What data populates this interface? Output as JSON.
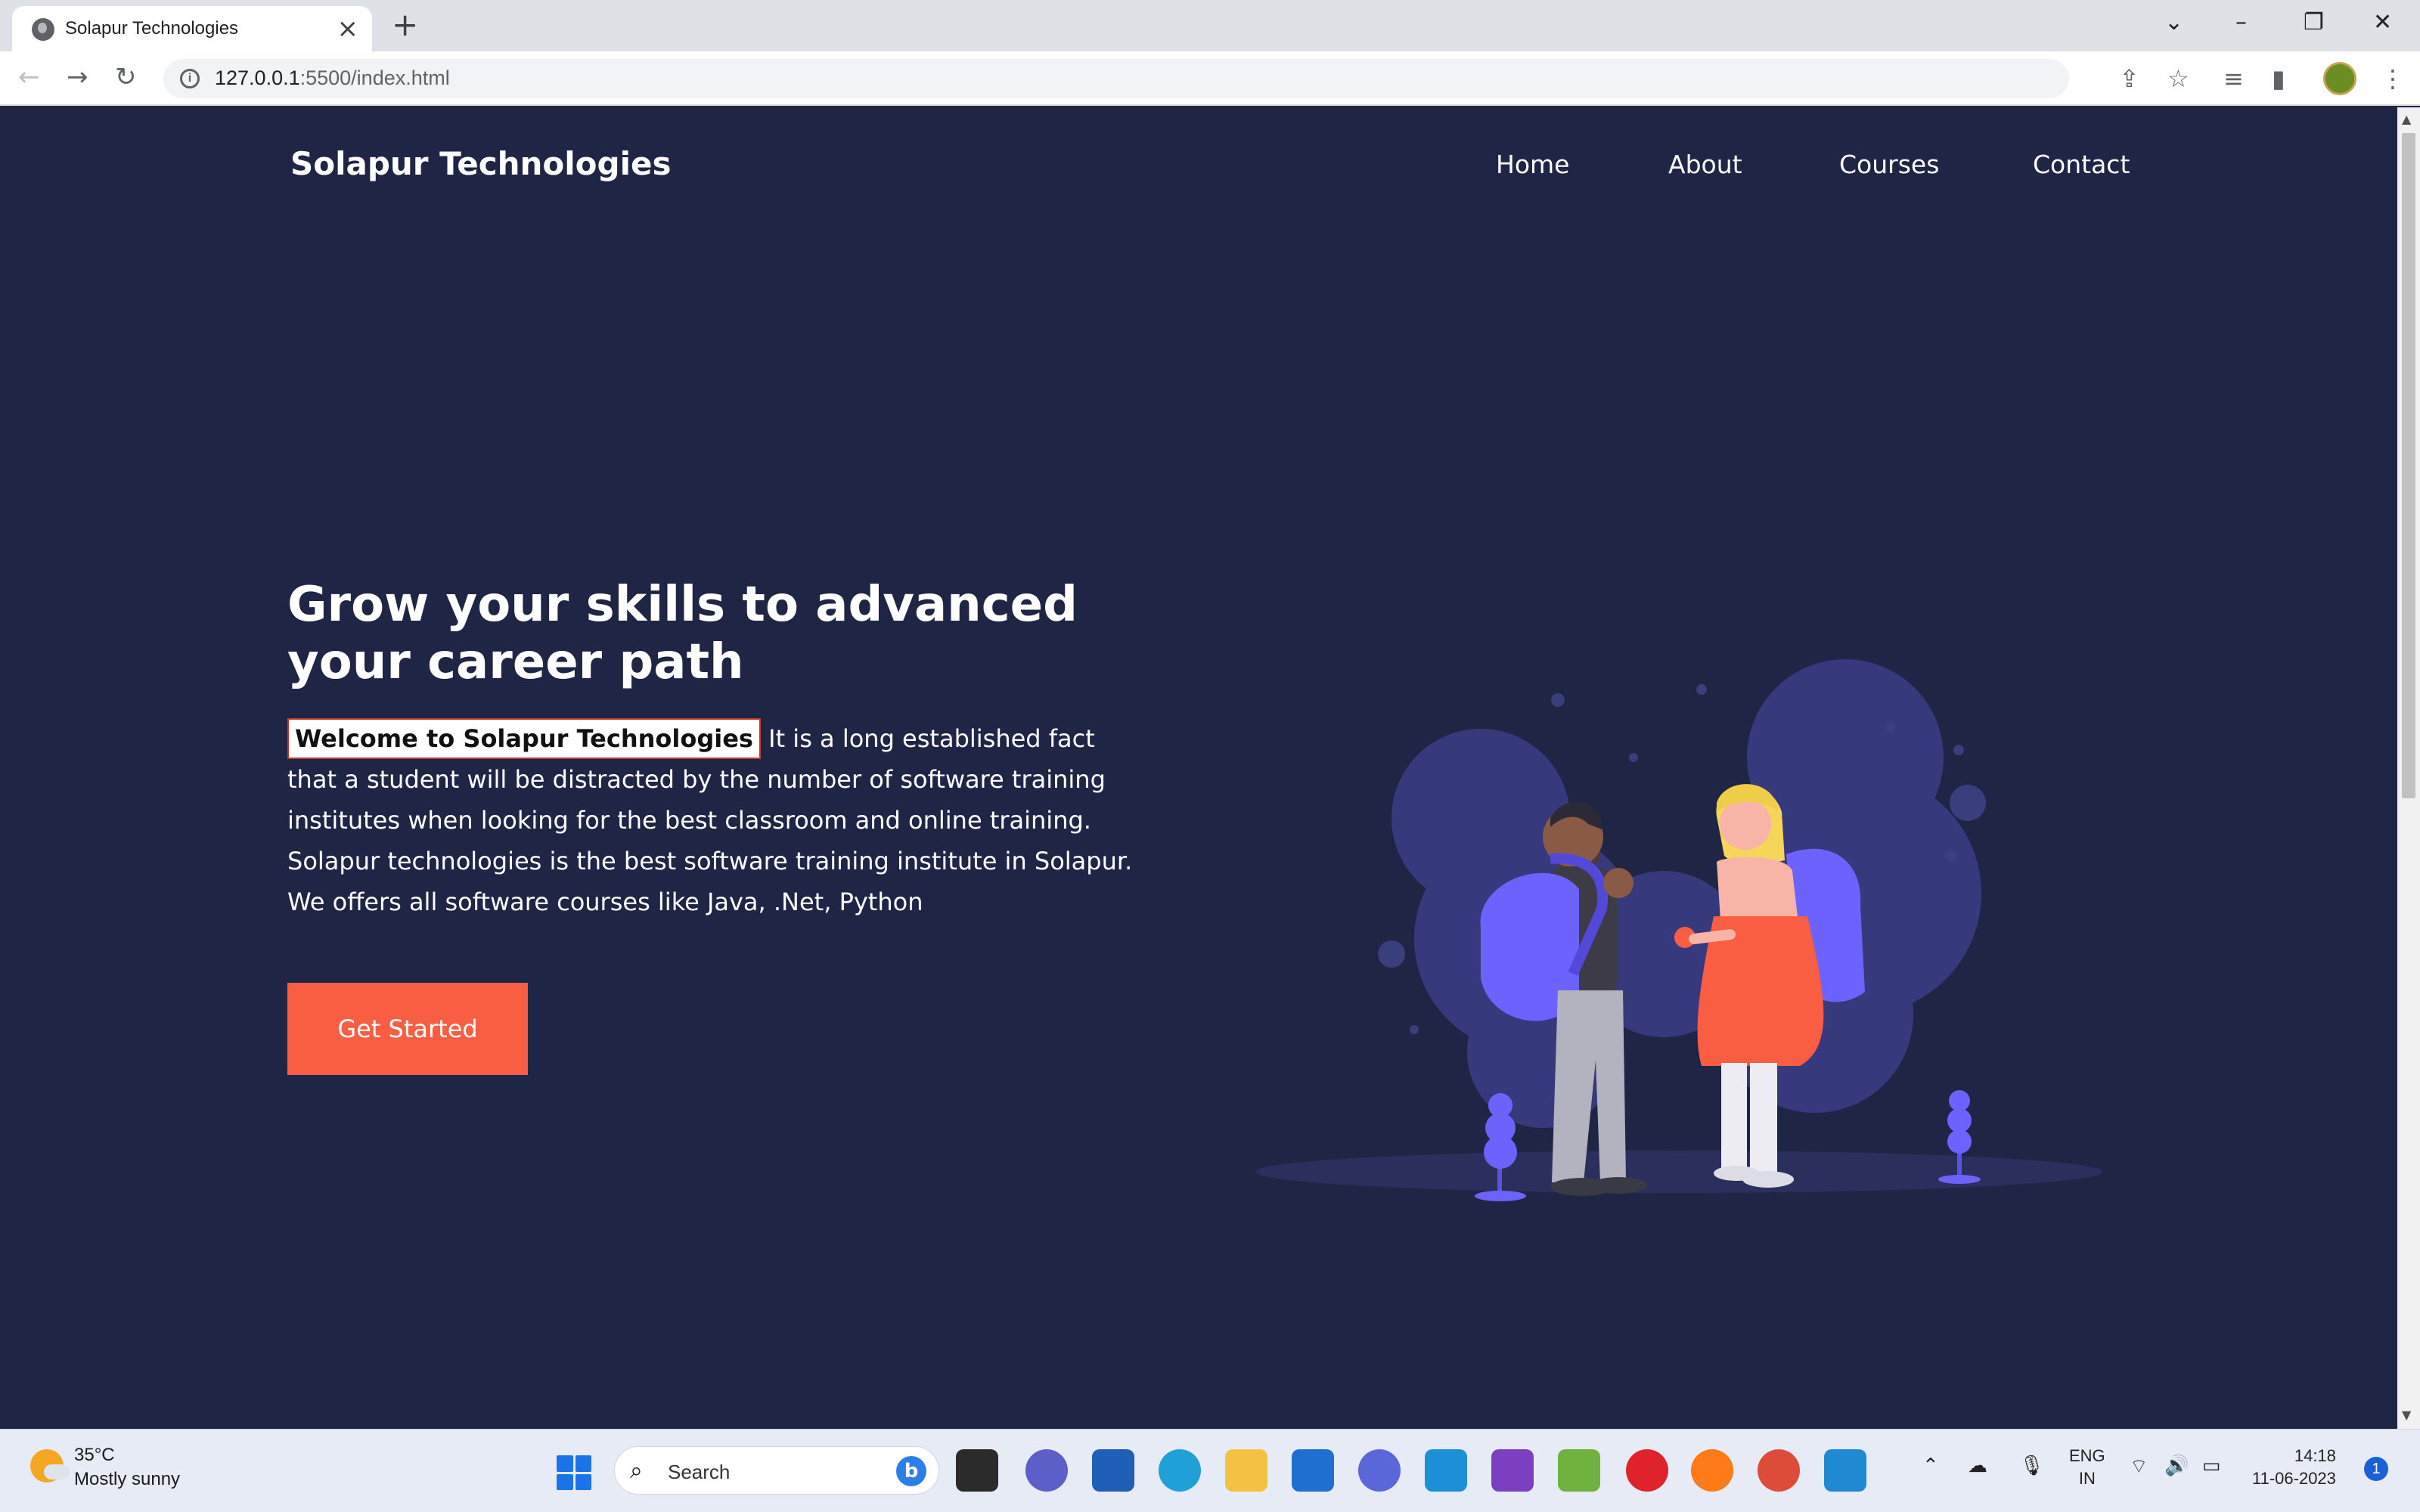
{
  "browser": {
    "tab_title": "Solapur Technologies",
    "url_host": "127.0.0.1",
    "url_rest": ":5500/index.html"
  },
  "site": {
    "brand": "Solapur Technologies",
    "nav": [
      "Home",
      "About",
      "Courses",
      "Contact"
    ],
    "hero": {
      "title": "Grow your skills to advanced your career path",
      "welcome": "Welcome to Solapur Technologies",
      "body": "It is a long established fact that a student will be distracted by the number of software training institutes when looking for the best classroom and online training. Solapur technologies is the best software training institute in Solapur. We offers all software courses like Java, .Net, Python",
      "cta": "Get Started"
    },
    "colors": {
      "background": "#1f2544",
      "accent": "#f95d42",
      "illustration": "#373b78"
    }
  },
  "taskbar": {
    "weather_temp": "35°C",
    "weather_condition": "Mostly sunny",
    "search_placeholder": "Search",
    "lang_top": "ENG",
    "lang_bottom": "IN",
    "time": "14:18",
    "date": "11-06-2023",
    "notification_count": "1",
    "apps": [
      "windows-start-icon",
      "task-view-icon",
      "chat-icon",
      "store-icon",
      "edge-icon",
      "file-explorer-icon",
      "mail-icon",
      "copilot-icon",
      "prime-video-icon",
      "visual-studio-icon",
      "app-icon",
      "opera-icon",
      "firefox-icon",
      "chrome-icon",
      "vscode-icon"
    ]
  }
}
